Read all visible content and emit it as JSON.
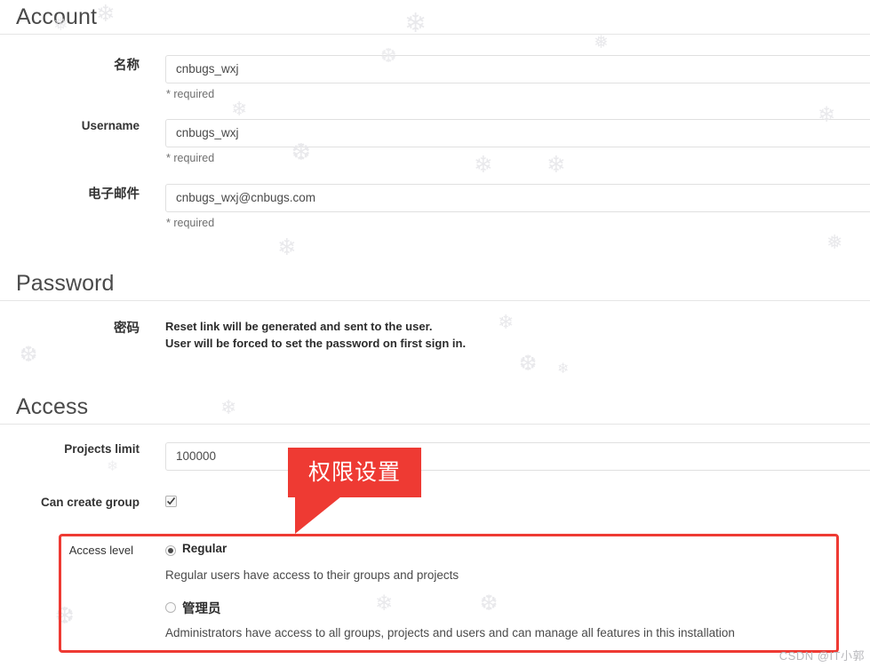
{
  "sections": {
    "account": {
      "title": "Account",
      "fields": [
        {
          "label": "名称",
          "value": "cnbugs_wxj",
          "hint": "* required"
        },
        {
          "label": "Username",
          "value": "cnbugs_wxj",
          "hint": "* required"
        },
        {
          "label": "电子邮件",
          "value": "cnbugs_wxj@cnbugs.com",
          "hint": "* required"
        }
      ]
    },
    "password": {
      "title": "Password",
      "label": "密码",
      "note_line1": "Reset link will be generated and sent to the user.",
      "note_line2": "User will be forced to set the password on first sign in."
    },
    "access": {
      "title": "Access",
      "projects_limit_label": "Projects limit",
      "projects_limit_value": "100000",
      "can_create_group_label": "Can create group",
      "can_create_group_checked": true,
      "access_level_label": "Access level",
      "options": [
        {
          "label": "Regular",
          "selected": true,
          "description": "Regular users have access to their groups and projects"
        },
        {
          "label": "管理员",
          "selected": false,
          "description": "Administrators have access to all groups, projects and users and can manage all features in this installation"
        }
      ]
    }
  },
  "annotations": {
    "callout_text": "权限设置",
    "callout_color": "#ee3a33",
    "highlight_box_color": "#ee3a33"
  },
  "watermark": {
    "text": "CSDN @IT小郭",
    "color": "#b9b9bd"
  }
}
